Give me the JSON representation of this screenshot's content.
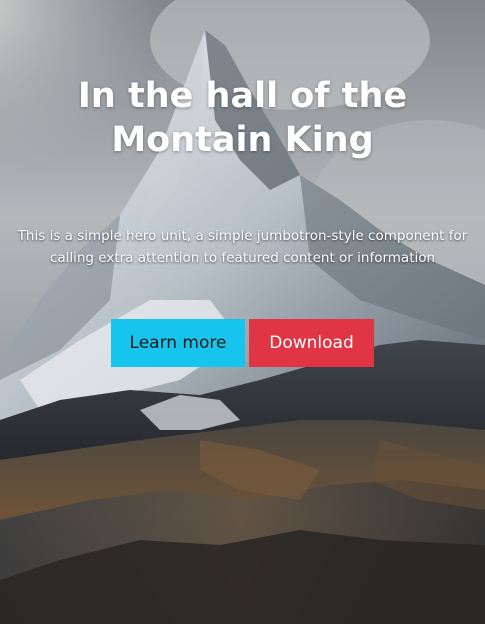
{
  "hero": {
    "title_line1": "In the hall of the",
    "title_line2": "Montain King",
    "lead_line1": "This is a simple hero unit, a simple jumbotron-style component for",
    "lead_line2": "calling extra attention to featured content or information",
    "background_image": "mountain-peak-photo",
    "buttons": {
      "learn_more": {
        "label": "Learn more",
        "color": "#17c4ee",
        "text_color": "#1a1a1a"
      },
      "download": {
        "label": "Download",
        "color": "#e03545",
        "text_color": "#ffffff"
      }
    }
  }
}
